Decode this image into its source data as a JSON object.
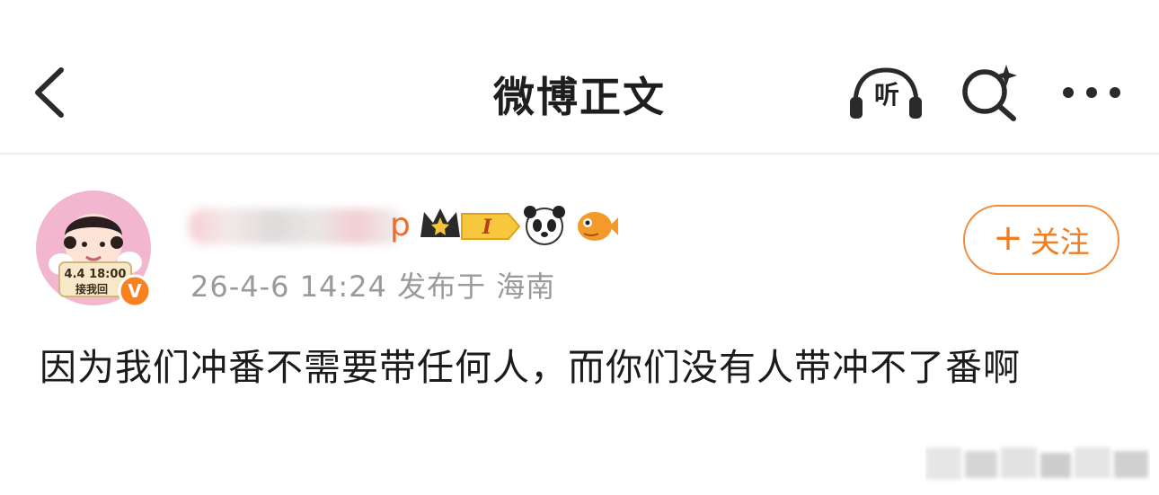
{
  "nav": {
    "back_icon": "chevron-left-icon",
    "title": "微博正文",
    "listen_label": "听",
    "listen_icon": "headphones-icon",
    "search_icon": "search-sparkle-icon",
    "more_icon": "more-icon"
  },
  "post": {
    "author_name_suffix": "p",
    "avatar_overlay_text": "4.4 18:00",
    "avatar_overlay_text2": "接我回",
    "verified_badge": "V",
    "badges": [
      "crown-badge-icon",
      "level-badge-icon",
      "panda-icon",
      "fish-icon"
    ],
    "level_label": "I",
    "meta": "26-4-6 14:24  发布于 海南",
    "follow_label": "关注",
    "follow_icon": "plus-icon",
    "text": "因为我们冲番不需要带任何人，而你们没有人带冲不了番啊"
  },
  "colors": {
    "accent": "#f07d22",
    "meta_gray": "#9a9a9a",
    "divider": "#ececec",
    "verified": "#f7821e"
  }
}
